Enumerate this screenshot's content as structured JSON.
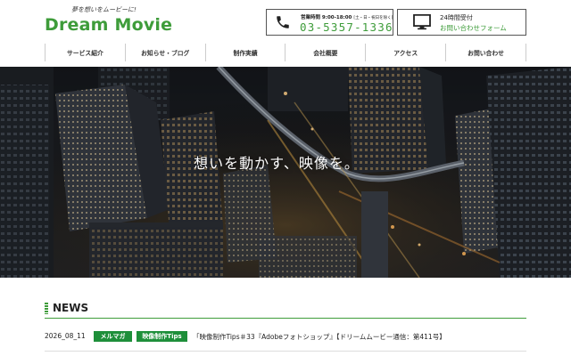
{
  "header": {
    "tagline": "夢を想いをムービーに!",
    "logo": "Dream Movie",
    "phone": {
      "hours_label": "営業時間 9:00-18:00",
      "hours_note": "[土・日・祝日を除く]",
      "number": "03-5357-1336"
    },
    "form": {
      "top_label": "24時間受付",
      "bottom_label": "お問い合わせフォーム"
    }
  },
  "nav": {
    "items": [
      {
        "label": "サービス紹介"
      },
      {
        "label": "お知らせ・ブログ"
      },
      {
        "label": "制作実績"
      },
      {
        "label": "会社概要"
      },
      {
        "label": "アクセス"
      },
      {
        "label": "お問い合わせ"
      }
    ]
  },
  "hero": {
    "caption": "想いを動かす、映像を。"
  },
  "news": {
    "title": "NEWS",
    "items": [
      {
        "date": "2026_08_11",
        "tags": [
          "メルマガ",
          "映像制作Tips"
        ],
        "title": "「映像制作Tips＃33『Adobeフォトショップ』【ドリームムービー通信：第411号】"
      }
    ]
  },
  "colors": {
    "brand_green": "#3e9c3a",
    "badge_green": "#1e8f3a"
  }
}
